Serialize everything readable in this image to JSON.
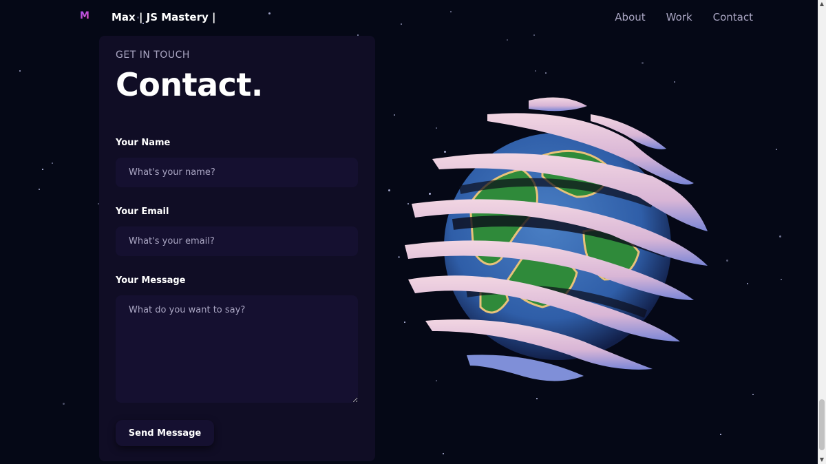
{
  "navbar": {
    "logo": "M",
    "brand": "Max | JS Mastery |",
    "links": [
      "About",
      "Work",
      "Contact"
    ]
  },
  "contact": {
    "subtitle": "GET IN TOUCH",
    "title": "Contact.",
    "name": {
      "label": "Your Name",
      "placeholder": "What's your name?",
      "value": ""
    },
    "email": {
      "label": "Your Email",
      "placeholder": "What's your email?",
      "value": ""
    },
    "message": {
      "label": "Your Message",
      "placeholder": "What do you want to say?",
      "value": ""
    },
    "send_label": "Send Message"
  },
  "colors": {
    "background": "#050816",
    "card": "#100d25",
    "input": "#151030",
    "muted_text": "#aaa6c3",
    "accent_gradient": [
      "#a855f7",
      "#ec4899"
    ]
  },
  "scrollbar": {
    "up_icon": "scroll-up-arrow-icon",
    "down_icon": "scroll-down-arrow-icon"
  }
}
